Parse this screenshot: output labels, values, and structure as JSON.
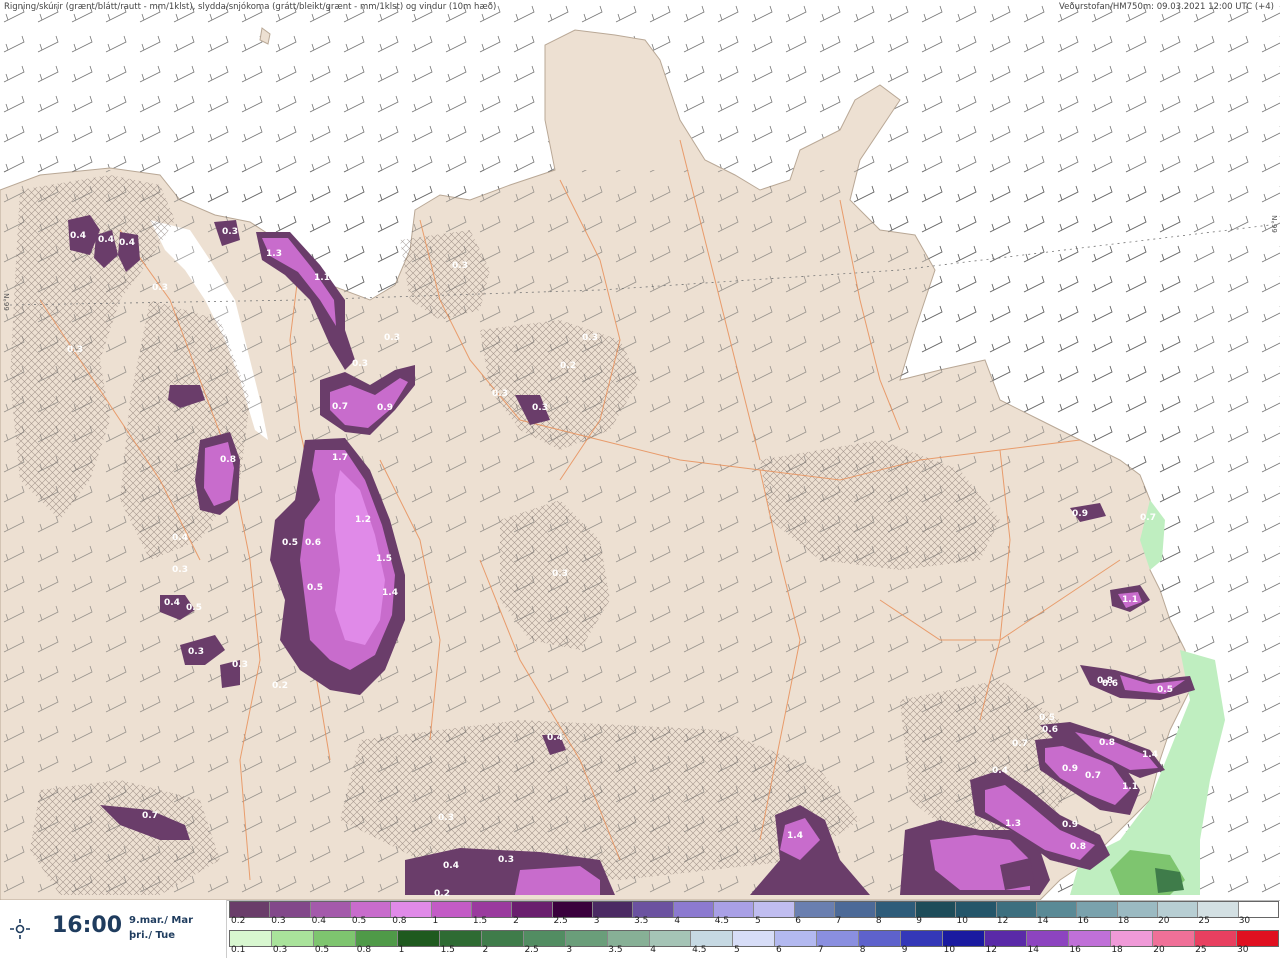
{
  "header": {
    "left_text": "Rigning/skúrir (grænt/blátt/rautt - mm/1klst), slydda/snjókoma (grátt/bleikt/grænt - mm/1klst) og vindur (10m hæð)",
    "right_text": "Veðurstofan/HM750m: 09.03.2021 12:00 UTC (+4)"
  },
  "grid_label": "66°N",
  "time_panel": {
    "time": "16:00",
    "date_line1": "9.mar./ Mar",
    "date_line2": "þri./ Tue",
    "icon": "sun-cloud-icon"
  },
  "legend_snow": {
    "labels": [
      "0.2",
      "0.3",
      "0.4",
      "0.5",
      "0.8",
      "1",
      "1.5",
      "2",
      "2.5",
      "3",
      "3.5",
      "4",
      "4.5",
      "5",
      "6",
      "7",
      "8",
      "9",
      "10",
      "12",
      "14",
      "16",
      "18",
      "20",
      "25",
      "30"
    ],
    "colors": [
      "#6a3d6a",
      "#82488a",
      "#a45aab",
      "#c86ccc",
      "#e08ae8",
      "#c35bc6",
      "#9a3a9e",
      "#6a1f6e",
      "#3a003d",
      "#4b2a63",
      "#6b52a0",
      "#8c7ad0",
      "#a9a0e6",
      "#c0bdf0",
      "#6a7fb0",
      "#4c6a98",
      "#2e5c7a",
      "#1e4d5a",
      "#24566a",
      "#3d6f7f",
      "#5a8a96",
      "#7aa2ad",
      "#9bbac2",
      "#b7ced3",
      "#d3e0e3",
      "#ffffff"
    ]
  },
  "legend_rain": {
    "labels": [
      "0.1",
      "0.3",
      "0.5",
      "0.8",
      "1",
      "1.5",
      "2",
      "2.5",
      "3",
      "3.5",
      "4",
      "4.5",
      "5",
      "6",
      "7",
      "8",
      "9",
      "10",
      "12",
      "14",
      "16",
      "18",
      "20",
      "25",
      "30"
    ],
    "colors": [
      "#d8f7d0",
      "#a9e39b",
      "#7ec56f",
      "#4f9a48",
      "#1f5a1f",
      "#2e6b33",
      "#3f7c4a",
      "#528d62",
      "#6a9e7a",
      "#87b096",
      "#a5c4b6",
      "#c6d9e3",
      "#d7ddf7",
      "#b3b9f0",
      "#8a8fe0",
      "#5e62cc",
      "#3438b8",
      "#1a1aa0",
      "#5a2aa8",
      "#8d44c0",
      "#c070d8",
      "#f09ad8",
      "#f07098",
      "#e84060",
      "#e01020"
    ]
  },
  "precip_labels": [
    "0.4",
    "0.4",
    "0.4",
    "0.3",
    "0.3",
    "1.3",
    "1.1",
    "0.3",
    "0.3",
    "0.3",
    "0.3",
    "0.2",
    "0.3",
    "0.7",
    "0.9",
    "0.3",
    "0.3",
    "0.8",
    "1.7",
    "1.2",
    "1.5",
    "1.4",
    "0.5",
    "0.6",
    "0.5",
    "0.2",
    "0.4",
    "0.3",
    "0.4",
    "0.5",
    "0.3",
    "0.3",
    "0.7",
    "0.4",
    "0.3",
    "0.2",
    "0.3",
    "0.4",
    "0.3",
    "1.4",
    "1.3",
    "0.9",
    "0.8",
    "0.4",
    "0.6",
    "0.5",
    "0.8",
    "0.9",
    "0.7",
    "1.1",
    "1.4",
    "0.8",
    "1.1",
    "0.9",
    "0.7",
    "0.7",
    "0.6",
    "0.5"
  ]
}
